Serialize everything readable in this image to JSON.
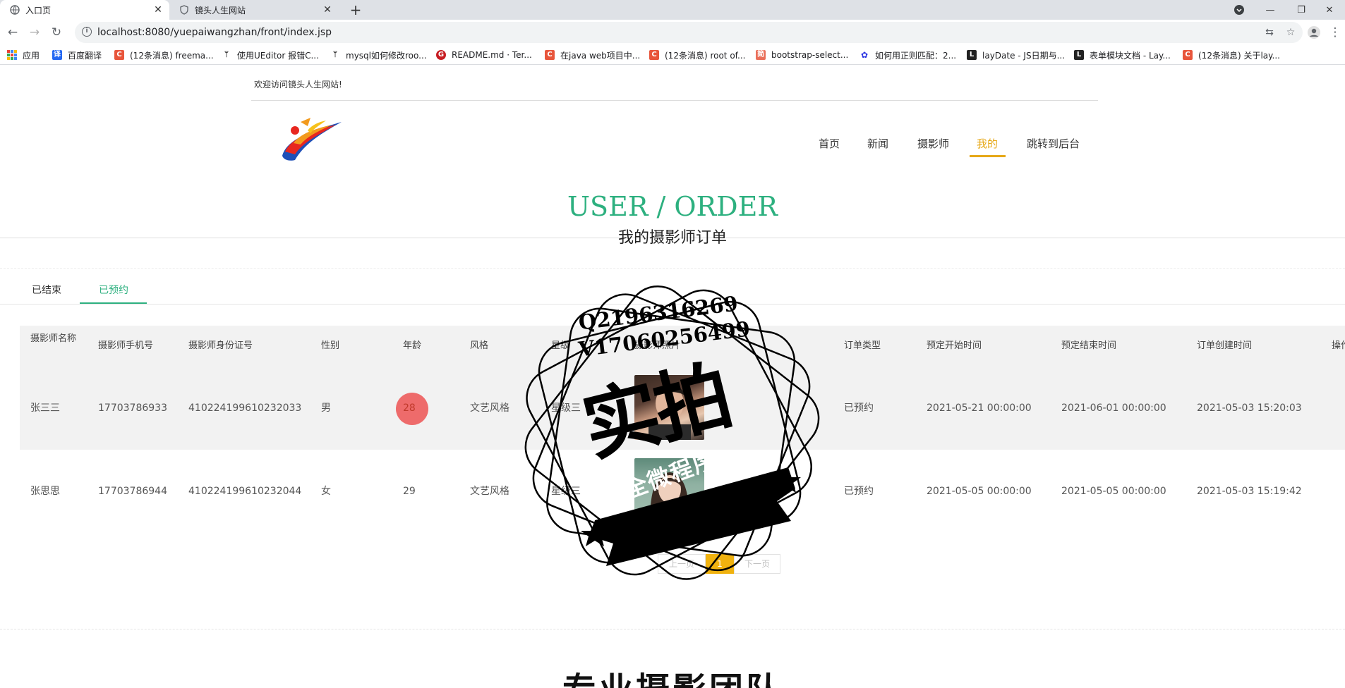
{
  "browser": {
    "tabs": [
      {
        "title": "入口页",
        "active": true
      },
      {
        "title": "镜头人生网站",
        "active": false
      }
    ],
    "url": "localhost:8080/yuepaiwangzhan/front/index.jsp",
    "bookmarks": [
      {
        "label": "应用",
        "icon": "apps-grid-icon",
        "color": "#4285f4"
      },
      {
        "label": "百度翻译",
        "icon": "baidu-translate-icon",
        "color": "#2468f2"
      },
      {
        "label": "(12条消息) freema...",
        "icon": "csdn-icon",
        "color": "#e8553b"
      },
      {
        "label": "使用UEditor 报错C...",
        "icon": "bird-icon",
        "color": "#333333"
      },
      {
        "label": "mysql如何修改roo...",
        "icon": "bird-icon",
        "color": "#333333"
      },
      {
        "label": "README.md · Ter...",
        "icon": "gitee-icon",
        "color": "#c71d23"
      },
      {
        "label": "在java web项目中...",
        "icon": "csdn-icon",
        "color": "#e8553b"
      },
      {
        "label": "(12条消息) root of...",
        "icon": "csdn-icon",
        "color": "#e8553b"
      },
      {
        "label": "bootstrap-select...",
        "icon": "jianshu-icon",
        "color": "#ea6f5a"
      },
      {
        "label": "如何用正则匹配：2...",
        "icon": "baidu-paw-icon",
        "color": "#2932e1"
      },
      {
        "label": "layDate - JS日期与...",
        "icon": "layui-icon",
        "color": "#222222"
      },
      {
        "label": "表单模块文档 - Lay...",
        "icon": "layui-icon",
        "color": "#222222"
      },
      {
        "label": "(12条消息) 关于lay...",
        "icon": "csdn-icon",
        "color": "#e8553b"
      }
    ]
  },
  "site": {
    "welcome": "欢迎访问镜头人生网站!",
    "nav": [
      {
        "label": "首页",
        "active": false
      },
      {
        "label": "新闻",
        "active": false
      },
      {
        "label": "摄影师",
        "active": false
      },
      {
        "label": "我的",
        "active": true
      },
      {
        "label": "跳转到后台",
        "active": false
      }
    ],
    "accent": "#e6a817",
    "green": "#2db07f"
  },
  "section": {
    "title_en": "USER / ORDER",
    "title_zh": "我的摄影师订单"
  },
  "subtabs": [
    {
      "label": "已结束",
      "active": false
    },
    {
      "label": "已预约",
      "active": true
    }
  ],
  "table": {
    "headers": [
      "摄影师名称",
      "摄影师手机号",
      "摄影师身份证号",
      "性别",
      "年龄",
      "风格",
      "星级",
      "摄影师照片",
      "订单类型",
      "预定开始时间",
      "预定结束时间",
      "订单创建时间",
      "操作"
    ],
    "rows": [
      {
        "name": "张三三",
        "phone": "17703786933",
        "idcard": "410224199610232033",
        "gender": "男",
        "age": "28",
        "style": "文艺风格",
        "star": "星级三",
        "type": "已预约",
        "start": "2021-05-21 00:00:00",
        "end": "2021-06-01 00:00:00",
        "created": "2021-05-03 15:20:03"
      },
      {
        "name": "张思思",
        "phone": "17703786944",
        "idcard": "410224199610232044",
        "gender": "女",
        "age": "29",
        "style": "文艺风格",
        "star": "星级三",
        "type": "已预约",
        "start": "2021-05-05 00:00:00",
        "end": "2021-05-05 00:00:00",
        "created": "2021-05-03 15:19:42"
      }
    ]
  },
  "pager": {
    "prev": "上一页",
    "current": "1",
    "next": "下一页"
  },
  "bottom_title": "专业摄影团队",
  "watermark": {
    "line1": "Q2196316269",
    "line2": "V17060256499",
    "big": "实拍",
    "ribbon": "全微程序"
  }
}
